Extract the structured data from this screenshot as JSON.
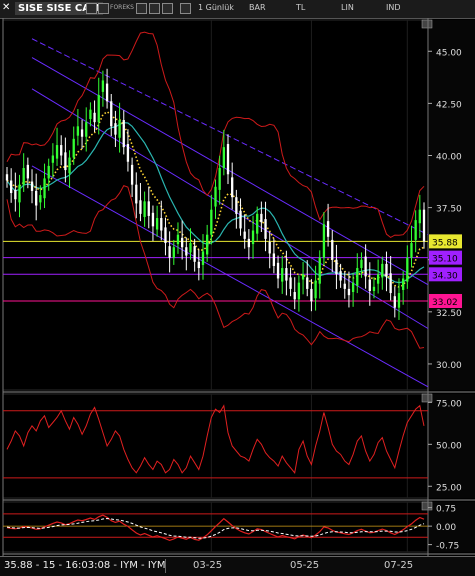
{
  "toolbar": {
    "symbol": "SISE SISE CAM",
    "forex_label": "FOREKS",
    "period": "1 Günlük",
    "chart_type": "BAR",
    "currency": "TL",
    "scale": "LIN",
    "indicators": "IND"
  },
  "status": {
    "text": "35.88 - 15 - 16:03:08 - IYM - IYM",
    "dates": [
      "03-25",
      "05-25",
      "07-25"
    ]
  },
  "colors": {
    "up": "#33ff33",
    "down": "#ffffff",
    "bollinger": "#cc1a1a",
    "channel": "#6a2cff",
    "ma": "#2ab5b0",
    "sar": "#ffd633",
    "last_price": "#e8e830",
    "level_purple": "#a020ff",
    "level_pink": "#ff1493"
  },
  "chart_data": [
    {
      "type": "candlestick",
      "panel": "price",
      "ylim": [
        28.75,
        46.5
      ],
      "yticks": [
        30.0,
        32.5,
        35.0,
        37.5,
        40.0,
        42.5,
        45.0
      ],
      "xlabels": [
        "03-25",
        "05-25",
        "07-25"
      ],
      "label_positions": [
        49,
        73,
        96
      ],
      "close": [
        38.8,
        38.2,
        37.9,
        38.6,
        39.4,
        38.9,
        38.3,
        37.6,
        38.1,
        38.9,
        39.5,
        40.0,
        40.5,
        40.0,
        39.3,
        39.9,
        40.8,
        41.4,
        40.9,
        41.6,
        42.2,
        41.6,
        42.9,
        43.6,
        42.6,
        41.4,
        41.0,
        41.7,
        40.4,
        39.7,
        38.6,
        37.7,
        37.2,
        37.8,
        37.1,
        36.6,
        37.0,
        36.4,
        35.8,
        35.1,
        35.6,
        36.2,
        35.6,
        35.2,
        35.8,
        34.9,
        34.6,
        35.4,
        36.2,
        37.4,
        38.5,
        39.4,
        40.4,
        39.1,
        38.0,
        37.2,
        36.5,
        36.0,
        35.6,
        36.4,
        37.2,
        36.8,
        36.0,
        35.3,
        34.7,
        34.1,
        34.6,
        34.0,
        33.6,
        33.1,
        33.9,
        34.3,
        33.6,
        33.0,
        34.0,
        35.1,
        36.7,
        36.1,
        35.0,
        34.3,
        34.0,
        33.6,
        33.3,
        33.9,
        34.6,
        35.0,
        34.2,
        33.5,
        33.7,
        34.3,
        34.8,
        34.2,
        33.4,
        32.7,
        33.4,
        34.1,
        35.1,
        35.8,
        36.9,
        37.4,
        35.88
      ],
      "levels": [
        {
          "value": 35.88,
          "label": "35.88",
          "color": "#e8e830"
        },
        {
          "value": 35.1,
          "label": "35.10",
          "color": "#a020ff"
        },
        {
          "value": 34.3,
          "label": "34.30",
          "color": "#a020ff"
        },
        {
          "value": 33.02,
          "label": "33.02",
          "color": "#ff1493"
        }
      ]
    },
    {
      "type": "line",
      "panel": "oscillator",
      "ylim": [
        18,
        80
      ],
      "yticks": [
        25.0,
        50.0,
        75.0
      ],
      "ylabels": [
        "25.00",
        "50.00",
        "75.00"
      ],
      "reference_lines": [
        70,
        30
      ],
      "values": [
        47,
        52,
        58,
        55,
        49,
        57,
        61,
        58,
        64,
        67,
        60,
        63,
        66,
        70,
        64,
        59,
        66,
        62,
        56,
        61,
        68,
        72,
        65,
        57,
        49,
        53,
        58,
        55,
        47,
        41,
        36,
        33,
        37,
        42,
        38,
        35,
        40,
        38,
        33,
        35,
        41,
        38,
        33,
        36,
        43,
        39,
        35,
        43,
        55,
        66,
        71,
        69,
        73,
        57,
        49,
        46,
        43,
        42,
        40,
        47,
        53,
        50,
        45,
        42,
        40,
        37,
        43,
        39,
        36,
        33,
        47,
        52,
        43,
        38,
        49,
        58,
        69,
        60,
        50,
        46,
        44,
        40,
        38,
        44,
        52,
        55,
        46,
        40,
        44,
        51,
        54,
        46,
        41,
        36,
        46,
        55,
        63,
        67,
        71,
        73,
        61
      ]
    },
    {
      "type": "line",
      "panel": "macd",
      "ylim": [
        -1.05,
        0.98
      ],
      "yticks": [
        -0.75,
        0.0,
        0.75
      ],
      "ylabels": [
        "-0.75",
        "0.00",
        "0.75"
      ],
      "reference_lines": [
        0.5,
        -0.45
      ],
      "series": [
        {
          "values": [
            -0.06,
            -0.09,
            -0.11,
            -0.08,
            -0.02,
            -0.04,
            -0.08,
            -0.13,
            -0.11,
            -0.03,
            0.04,
            0.11,
            0.17,
            0.13,
            0.06,
            0.1,
            0.18,
            0.25,
            0.22,
            0.27,
            0.33,
            0.27,
            0.38,
            0.45,
            0.36,
            0.22,
            0.15,
            0.2,
            0.08,
            -0.01,
            -0.15,
            -0.28,
            -0.36,
            -0.3,
            -0.37,
            -0.44,
            -0.39,
            -0.45,
            -0.51,
            -0.58,
            -0.52,
            -0.44,
            -0.49,
            -0.53,
            -0.46,
            -0.54,
            -0.57,
            -0.47,
            -0.35,
            -0.19,
            -0.02,
            0.14,
            0.3,
            0.17,
            0.02,
            -0.1,
            -0.2,
            -0.27,
            -0.32,
            -0.22,
            -0.11,
            -0.14,
            -0.22,
            -0.3,
            -0.37,
            -0.44,
            -0.38,
            -0.43,
            -0.47,
            -0.52,
            -0.42,
            -0.36,
            -0.42,
            -0.47,
            -0.36,
            -0.22,
            -0.03,
            -0.07,
            -0.17,
            -0.24,
            -0.27,
            -0.31,
            -0.34,
            -0.27,
            -0.18,
            -0.13,
            -0.2,
            -0.27,
            -0.25,
            -0.18,
            -0.12,
            -0.18,
            -0.27,
            -0.34,
            -0.25,
            -0.15,
            -0.02,
            0.09,
            0.24,
            0.35,
            0.28
          ]
        },
        {
          "values": [
            -0.04,
            -0.06,
            -0.08,
            -0.08,
            -0.06,
            -0.05,
            -0.06,
            -0.08,
            -0.09,
            -0.07,
            -0.05,
            -0.02,
            0.02,
            0.05,
            0.06,
            0.07,
            0.09,
            0.12,
            0.15,
            0.18,
            0.21,
            0.22,
            0.25,
            0.29,
            0.31,
            0.29,
            0.26,
            0.25,
            0.21,
            0.17,
            0.11,
            0.04,
            -0.03,
            -0.08,
            -0.13,
            -0.19,
            -0.23,
            -0.27,
            -0.32,
            -0.37,
            -0.4,
            -0.41,
            -0.43,
            -0.45,
            -0.45,
            -0.47,
            -0.49,
            -0.48,
            -0.46,
            -0.41,
            -0.34,
            -0.25,
            -0.14,
            -0.09,
            -0.07,
            -0.07,
            -0.1,
            -0.14,
            -0.18,
            -0.19,
            -0.17,
            -0.17,
            -0.18,
            -0.2,
            -0.24,
            -0.28,
            -0.3,
            -0.33,
            -0.36,
            -0.39,
            -0.4,
            -0.39,
            -0.4,
            -0.41,
            -0.4,
            -0.36,
            -0.3,
            -0.25,
            -0.23,
            -0.23,
            -0.24,
            -0.25,
            -0.27,
            -0.27,
            -0.25,
            -0.23,
            -0.22,
            -0.23,
            -0.23,
            -0.22,
            -0.2,
            -0.2,
            -0.21,
            -0.24,
            -0.24,
            -0.22,
            -0.18,
            -0.13,
            -0.05,
            0.04,
            0.1
          ]
        }
      ]
    }
  ]
}
